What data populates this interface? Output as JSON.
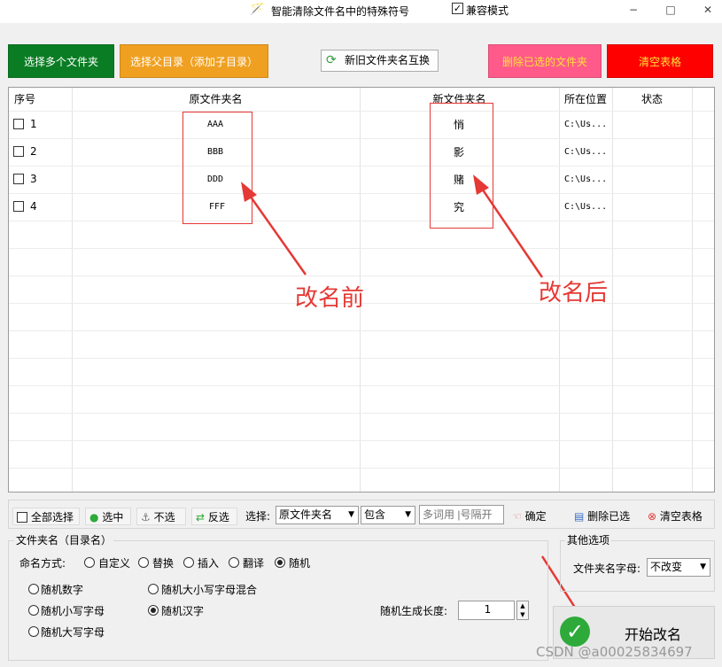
{
  "titlebar": {
    "title": "智能清除文件名中的特殊符号",
    "compat_label": "兼容模式",
    "minimize": "−",
    "maximize": "□",
    "close": "✕"
  },
  "top_buttons": {
    "select_multi": "选择多个文件夹",
    "select_parent": "选择父目录（添加子目录）",
    "swap": "新旧文件夹名互换",
    "delete_selected": "删除已选的文件夹",
    "clear_table": "清空表格"
  },
  "colors": {
    "green": "#0a7d24",
    "orange": "#f0a020",
    "pink": "#ff5a8a",
    "red": "#ff0000",
    "annot": "#e53935"
  },
  "table": {
    "headers": [
      "序号",
      "原文件夹名",
      "新文件夹名",
      "所在位置",
      "状态"
    ],
    "rows": [
      {
        "index": "1",
        "old": "AAA",
        "new": "悄",
        "location": "C:\\Us...",
        "status": ""
      },
      {
        "index": "2",
        "old": "BBB",
        "new": "影",
        "location": "C:\\Us...",
        "status": ""
      },
      {
        "index": "3",
        "old": "DDD",
        "new": "赌",
        "location": "C:\\Us...",
        "status": ""
      },
      {
        "index": "4",
        "old": "FFF",
        "new": "究",
        "location": "C:\\Us...",
        "status": ""
      }
    ]
  },
  "annotations": {
    "before": "改名前",
    "after": "改名后"
  },
  "toolbar": {
    "select_all": "全部选择",
    "check": "选中",
    "uncheck": "不选",
    "invert": "反选",
    "select_label": "选择:",
    "column_select": "原文件夹名",
    "match_select": "包含",
    "keyword_placeholder": "多词用 |号隔开",
    "confirm": "确定",
    "delete_selected": "删除已选",
    "clear_table": "清空表格"
  },
  "rename_group": {
    "title": "文件夹名（目录名）",
    "mode_label": "命名方式:",
    "modes": [
      "自定义",
      "替换",
      "插入",
      "翻译",
      "随机"
    ],
    "selected_mode": "随机",
    "random_options": {
      "col1": [
        "随机数字",
        "随机小写字母",
        "随机大写字母"
      ],
      "col2": [
        "随机大小写字母混合",
        "随机汉字"
      ]
    },
    "selected_random": "随机汉字",
    "length_label": "随机生成长度:",
    "length_value": "1"
  },
  "other_group": {
    "title": "其他选项",
    "case_label": "文件夹名字母:",
    "case_value": "不改变"
  },
  "start_button": "开始改名",
  "watermark": "CSDN @a00025834697"
}
